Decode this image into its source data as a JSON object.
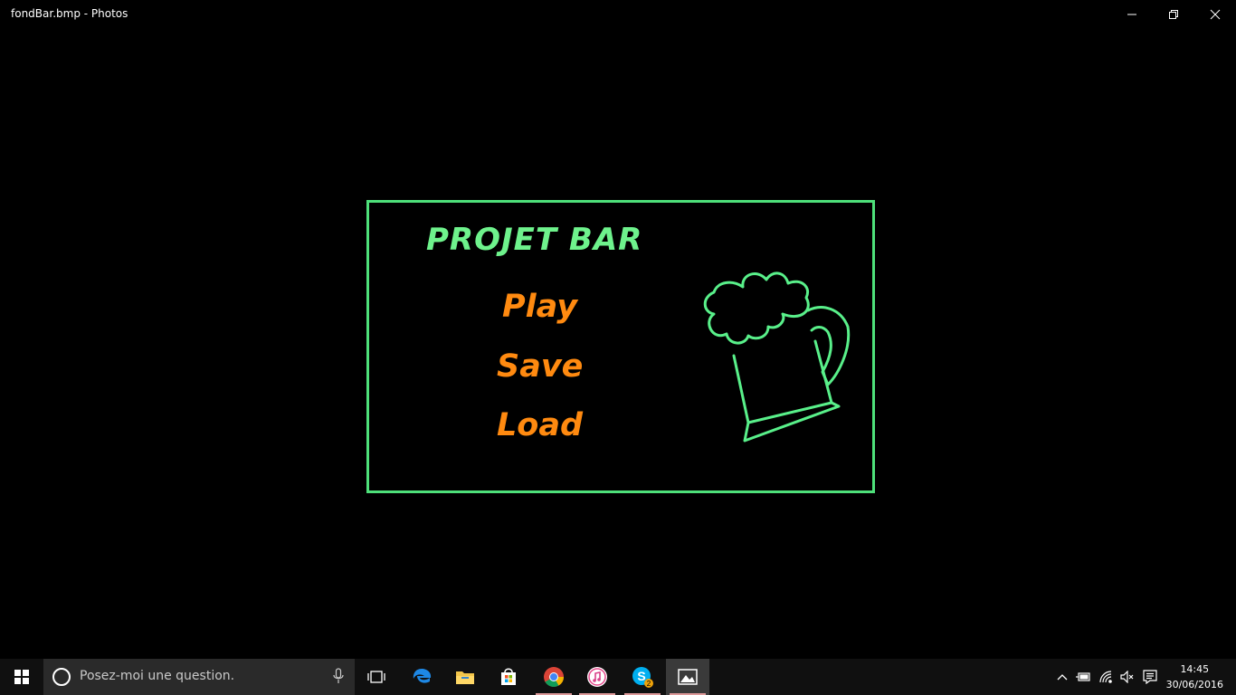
{
  "window": {
    "title": "fondBar.bmp - Photos"
  },
  "photo": {
    "title": "PROJET BAR",
    "menu": [
      "Play",
      "Save",
      "Load"
    ],
    "colors": {
      "frame": "#4ee07a",
      "title": "#6ef28c",
      "menu": "#ff8a10",
      "mug": "#59f08a"
    }
  },
  "taskbar": {
    "search_placeholder": "Posez-moi une question.",
    "skype_badge": "2",
    "clock": {
      "time": "14:45",
      "date": "30/06/2016"
    },
    "pinned": [
      "task-view-icon",
      "edge-icon",
      "file-explorer-icon",
      "store-icon",
      "chrome-icon",
      "itunes-icon",
      "skype-icon",
      "photos-icon"
    ]
  }
}
